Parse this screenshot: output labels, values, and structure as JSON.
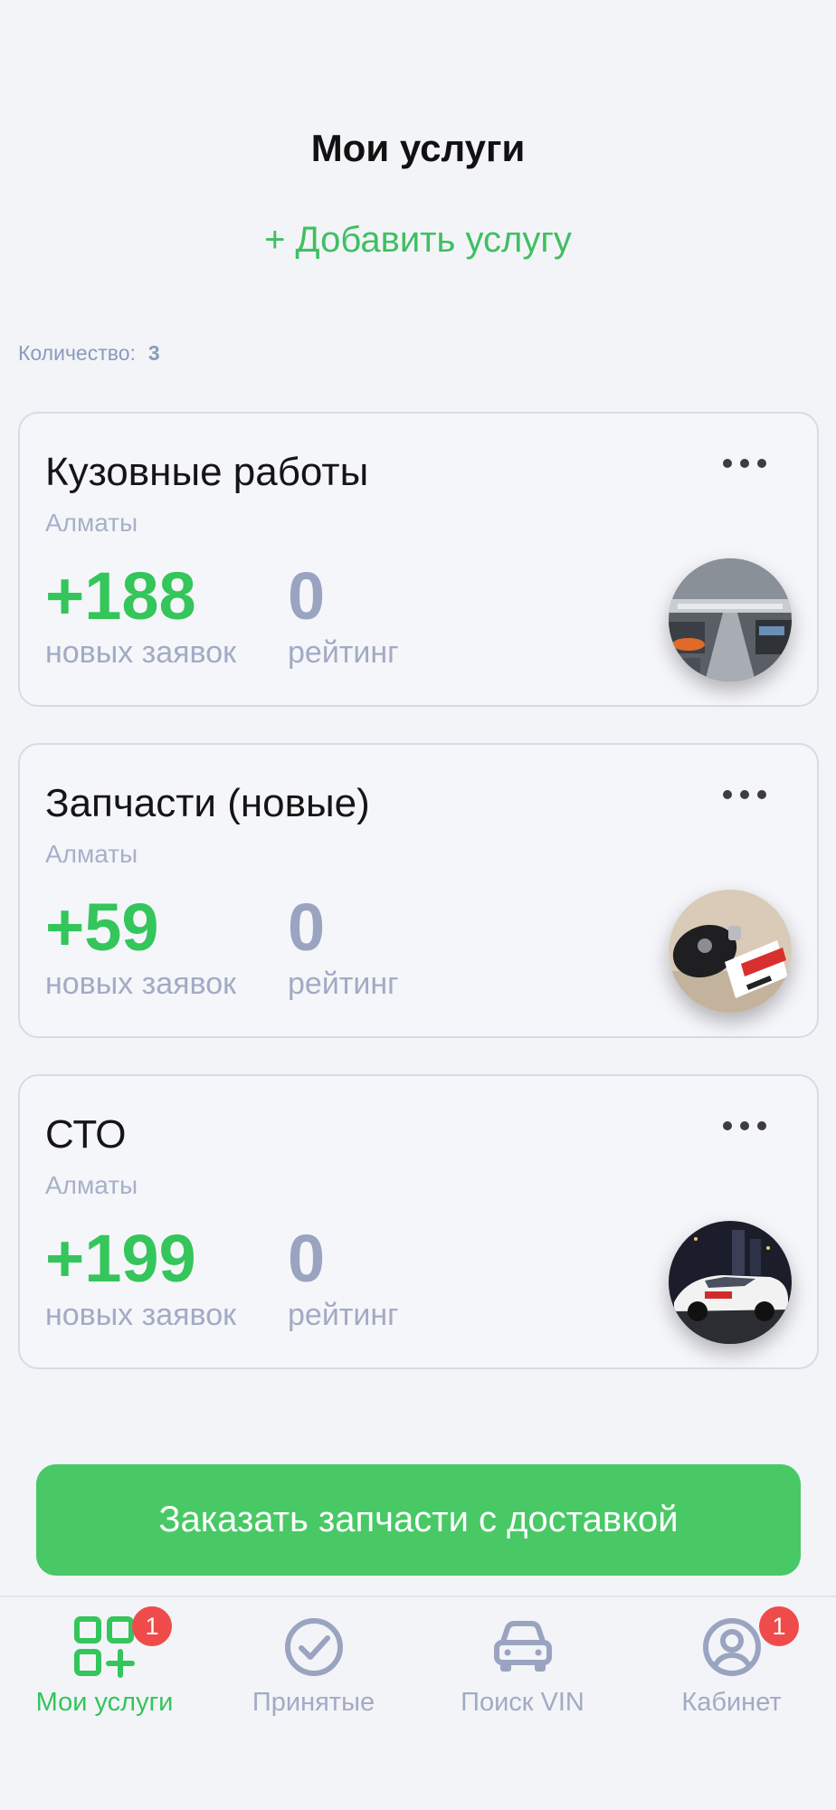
{
  "header": {
    "title": "Мои услуги",
    "add_service": "+ Добавить услугу"
  },
  "summary": {
    "count_label": "Количество:",
    "count_value": "3"
  },
  "services": [
    {
      "title": "Кузовные работы",
      "city": "Алматы",
      "new_requests": "+188",
      "new_requests_label": "новых заявок",
      "rating": "0",
      "rating_label": "рейтинг",
      "menu_icon": "more-icon",
      "image": "showroom-photo"
    },
    {
      "title": "Запчасти (новые)",
      "city": "Алматы",
      "new_requests": "+59",
      "new_requests_label": "новых заявок",
      "rating": "0",
      "rating_label": "рейтинг",
      "menu_icon": "more-icon",
      "image": "car-key-photo"
    },
    {
      "title": "СТО",
      "city": "Алматы",
      "new_requests": "+199",
      "new_requests_label": "новых заявок",
      "rating": "0",
      "rating_label": "рейтинг",
      "menu_icon": "more-icon",
      "image": "white-car-photo"
    }
  ],
  "cta": {
    "label": "Заказать запчасти с доставкой"
  },
  "tabbar": {
    "tabs": [
      {
        "label": "Мои услуги",
        "icon": "services-grid-icon",
        "active": true,
        "badge": "1"
      },
      {
        "label": "Принятые",
        "icon": "check-circle-icon",
        "active": false
      },
      {
        "label": "Поиск VIN",
        "icon": "car-icon",
        "active": false
      },
      {
        "label": "Кабинет",
        "icon": "user-circle-icon",
        "active": false,
        "badge": "1"
      }
    ]
  },
  "colors": {
    "accent": "#34c55b",
    "button": "#48c965",
    "badge": "#ef4b4b",
    "muted": "#a2abc4",
    "background": "#f3f4f8"
  }
}
